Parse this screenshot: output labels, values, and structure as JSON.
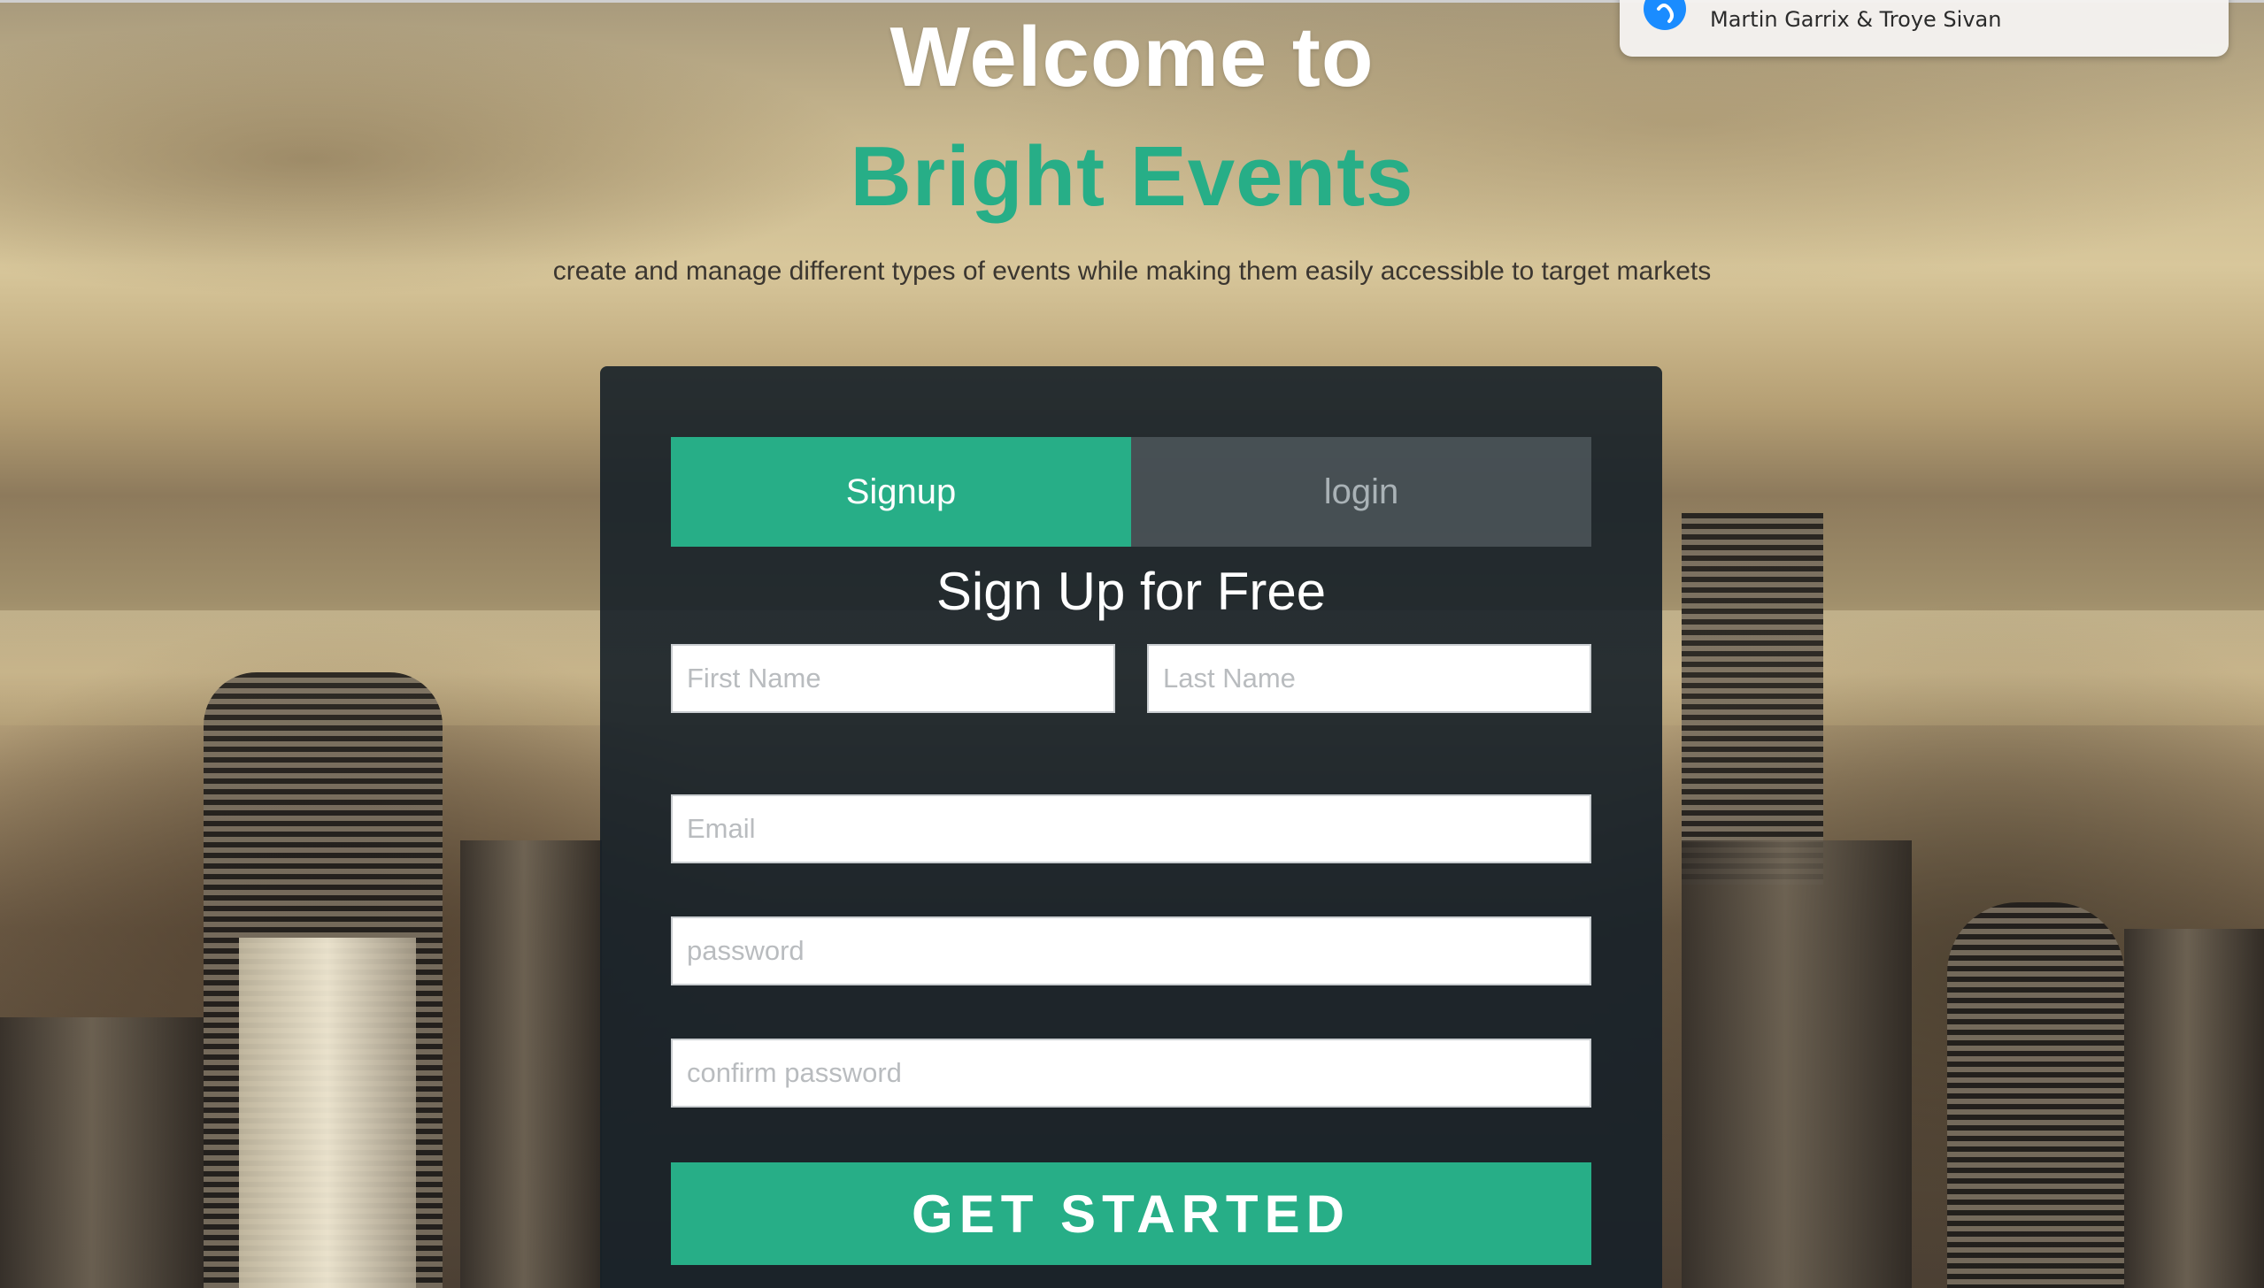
{
  "notification": {
    "icon": "shazam-icon",
    "text": "Martin Garrix & Troye Sivan"
  },
  "hero": {
    "title": "Welcome to",
    "brand": "Bright Events",
    "tagline": "create and manage different types of events while making them easily accessible to target markets"
  },
  "auth": {
    "tabs": {
      "signup": "Signup",
      "login": "login"
    },
    "active_tab": "signup",
    "form_title": "Sign Up for Free",
    "fields": {
      "first_name": {
        "placeholder": "First Name",
        "value": ""
      },
      "last_name": {
        "placeholder": "Last Name",
        "value": ""
      },
      "email": {
        "placeholder": "Email",
        "value": ""
      },
      "password": {
        "placeholder": "password",
        "value": ""
      },
      "confirm_password": {
        "placeholder": "confirm password",
        "value": ""
      }
    },
    "submit_label": "GET STARTED"
  },
  "colors": {
    "accent": "#27ae87",
    "card_bg": "#162028",
    "tab_inactive_text": "#a9b2b6",
    "white": "#ffffff"
  }
}
